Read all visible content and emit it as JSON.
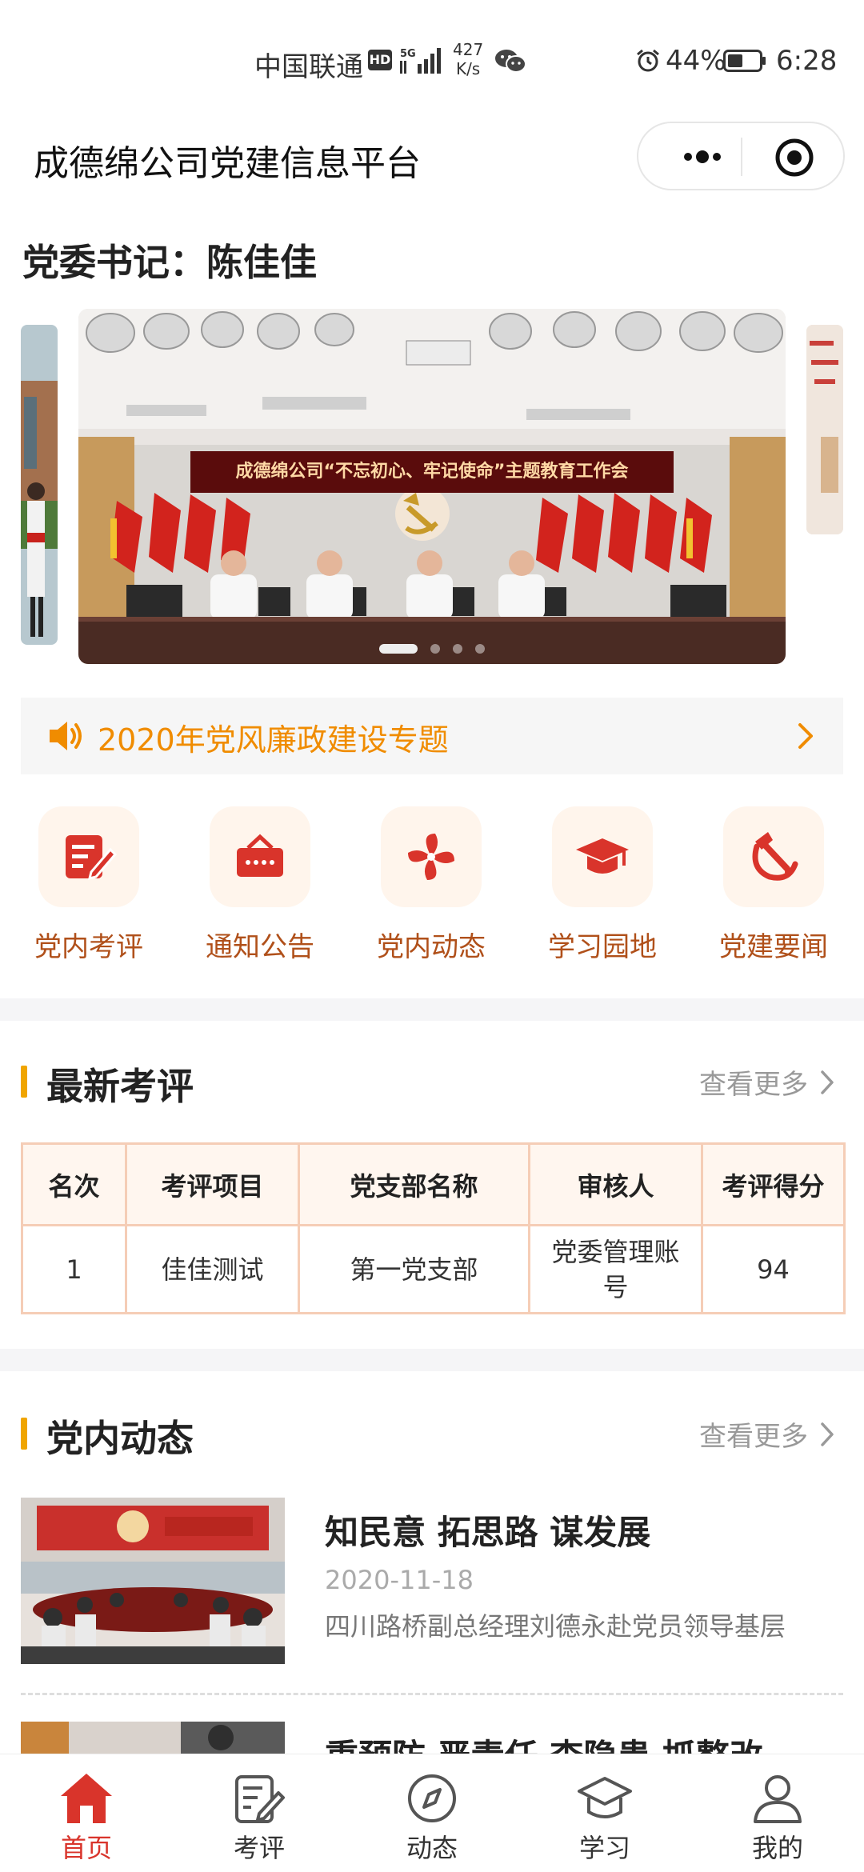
{
  "status_bar": {
    "carrier": "中国联通",
    "hd": "HD",
    "network": "5G",
    "speed_value": "427",
    "speed_unit": "K/s",
    "battery": "44%",
    "time": "6:28"
  },
  "header": {
    "title": "成德绵公司党建信息平台"
  },
  "secretary": "党委书记：陈佳佳",
  "carousel": {
    "banner_text": "成德绵公司“不忘初心、牢记使命”主题教育工作会",
    "slide_count": 4,
    "active_index": 0
  },
  "notice": {
    "text": "2020年党风廉政建设专题"
  },
  "menu": [
    {
      "label": "党内考评",
      "icon": "edit-document-icon"
    },
    {
      "label": "通知公告",
      "icon": "notice-board-icon"
    },
    {
      "label": "党内动态",
      "icon": "pinwheel-icon"
    },
    {
      "label": "学习园地",
      "icon": "graduation-cap-icon"
    },
    {
      "label": "党建要闻",
      "icon": "hammer-sickle-icon"
    }
  ],
  "evaluation": {
    "title": "最新考评",
    "more": "查看更多",
    "columns": [
      "名次",
      "考评项目",
      "党支部名称",
      "审核人",
      "考评得分"
    ],
    "rows": [
      {
        "rank": "1",
        "project": "佳佳测试",
        "branch": "第一党支部",
        "reviewer": "党委管理账号",
        "score": "94"
      }
    ]
  },
  "dynamics": {
    "title": "党内动态",
    "more": "查看更多",
    "items": [
      {
        "title": "知民意 拓思路 谋发展",
        "date": "2020-11-18",
        "desc": "四川路桥副总经理刘德永赴党员领导基层"
      },
      {
        "title": "重预防 严责任 查隐患 抓整改",
        "date": "",
        "desc": ""
      }
    ]
  },
  "tabbar": [
    {
      "label": "首页",
      "icon": "home-icon",
      "active": true
    },
    {
      "label": "考评",
      "icon": "edit-icon",
      "active": false
    },
    {
      "label": "动态",
      "icon": "compass-icon",
      "active": false
    },
    {
      "label": "学习",
      "icon": "graduation-cap-icon",
      "active": false
    },
    {
      "label": "我的",
      "icon": "user-icon",
      "active": false
    }
  ],
  "colors": {
    "accent_red": "#d9342b",
    "accent_orange": "#f08c00",
    "label_brown": "#b0501a",
    "section_bar": "#f0a500",
    "table_border": "#f5cdb6"
  }
}
